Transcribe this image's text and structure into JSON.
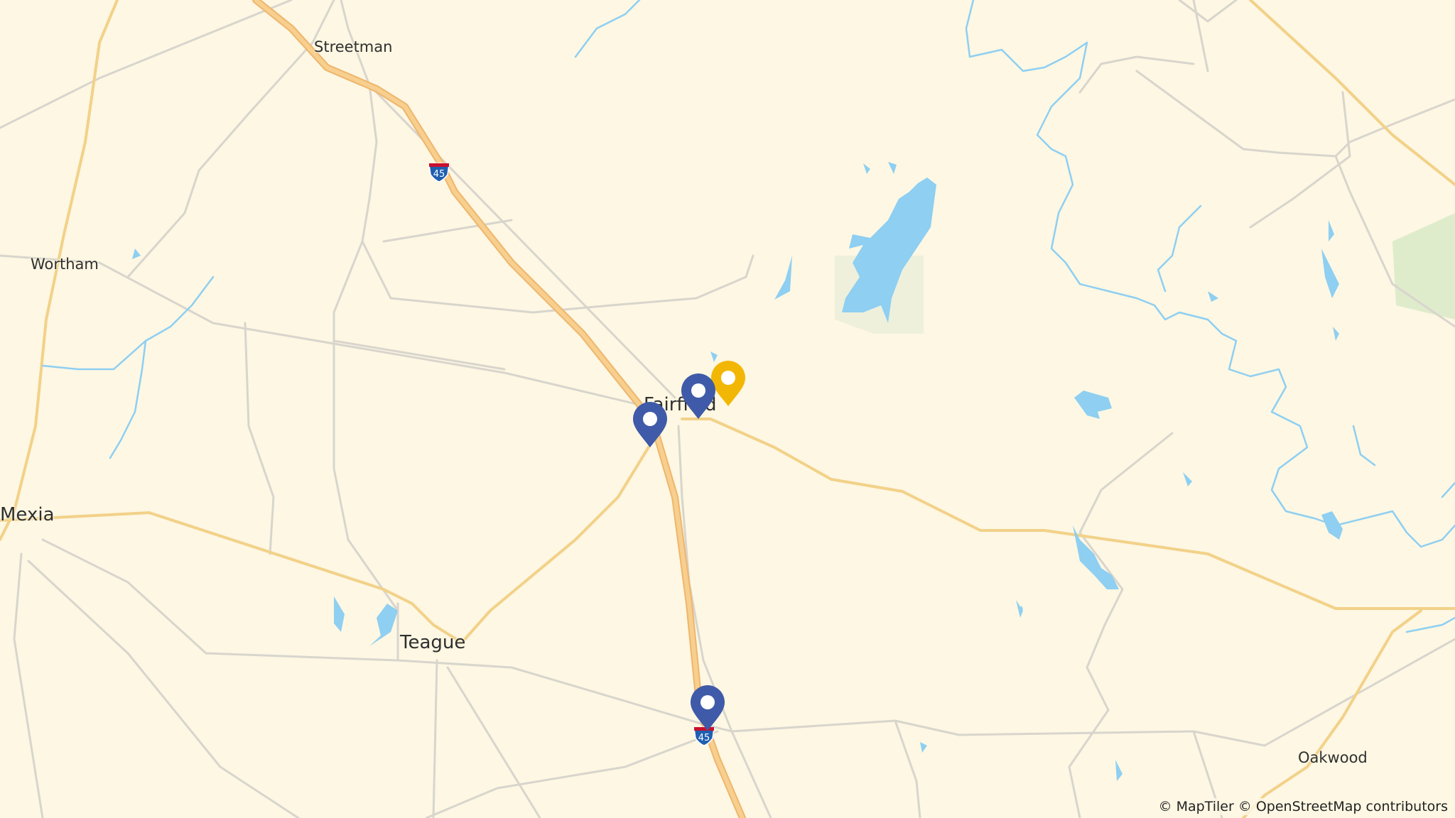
{
  "map": {
    "cities": [
      {
        "id": "streetman",
        "label": "Streetman",
        "size": "small"
      },
      {
        "id": "wortham",
        "label": "Wortham",
        "size": "small"
      },
      {
        "id": "mexia",
        "label": "Mexia",
        "size": "large"
      },
      {
        "id": "teague",
        "label": "Teague",
        "size": "large"
      },
      {
        "id": "fairfield",
        "label": "Fairfield",
        "size": "large"
      },
      {
        "id": "oakwood",
        "label": "Oakwood",
        "size": "small"
      }
    ],
    "shields": [
      {
        "id": "i45-north",
        "label": "45"
      },
      {
        "id": "i45-south",
        "label": "45"
      }
    ],
    "markers": [
      {
        "id": "marker-blue-1",
        "color": "#3f5aa8",
        "type": "blue"
      },
      {
        "id": "marker-blue-2",
        "color": "#3f5aa8",
        "type": "blue"
      },
      {
        "id": "marker-blue-3",
        "color": "#3f5aa8",
        "type": "blue"
      },
      {
        "id": "marker-yellow",
        "color": "#f2b705",
        "type": "highlight"
      }
    ],
    "colors": {
      "land": "#fdf7e3",
      "water": "#8ecff2",
      "road_major": "#f4c27a",
      "road_minor": "#d6d3cb",
      "interstate_shield": "#1f5fb0"
    },
    "attribution": "© MapTiler © OpenStreetMap contributors"
  }
}
